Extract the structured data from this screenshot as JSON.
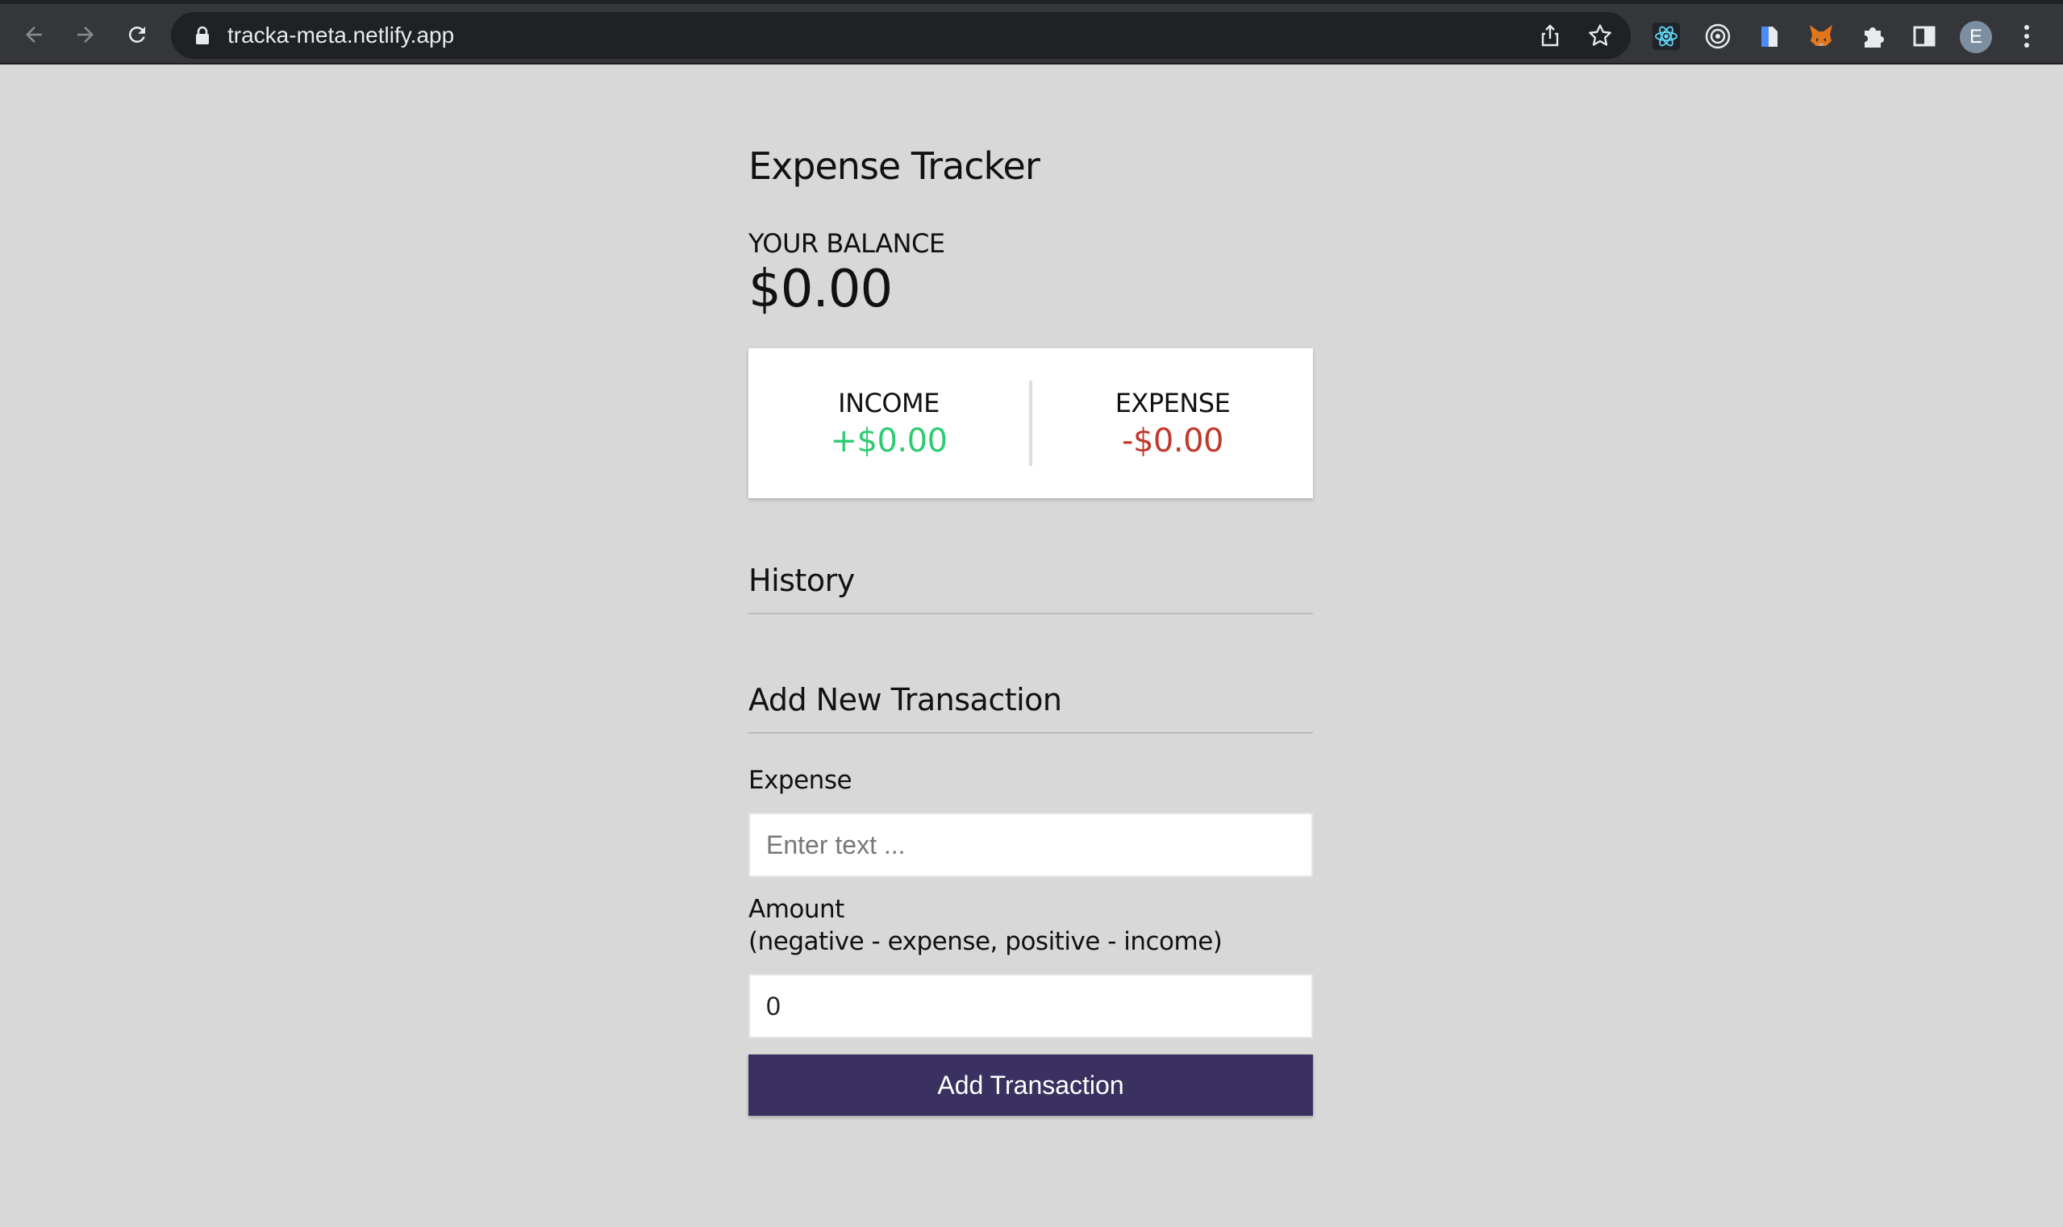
{
  "browser": {
    "url": "tracka-meta.netlify.app",
    "profile_initial": "E",
    "icons": [
      "back-arrow-icon",
      "forward-arrow-icon",
      "reload-icon",
      "lock-icon",
      "share-icon",
      "star-icon",
      "react-devtools-icon",
      "target-extension-icon",
      "bookmark-extension-icon",
      "metamask-fox-icon",
      "puzzle-extensions-icon",
      "side-panel-icon",
      "more-menu-icon"
    ]
  },
  "app": {
    "title": "Expense Tracker",
    "balance_label": "YOUR BALANCE",
    "balance_value": "$0.00",
    "income_label": "INCOME",
    "income_value": "+$0.00",
    "expense_label": "EXPENSE",
    "expense_value": "-$0.00",
    "history_heading": "History",
    "add_heading": "Add New Transaction",
    "text_label": "Expense",
    "text_placeholder": "Enter text ...",
    "amount_label": "Amount",
    "amount_hint": "(negative - expense, positive - income)",
    "amount_value": "0",
    "button_label": "Add Transaction"
  },
  "colors": {
    "income": "#2ecc71",
    "expense": "#c0392b",
    "button": "#3a3160",
    "page_bg": "#d8d8d8"
  }
}
